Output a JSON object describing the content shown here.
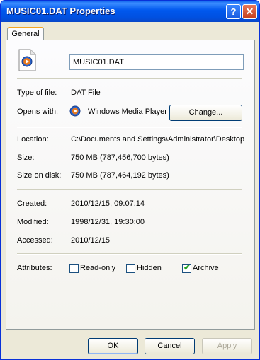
{
  "window": {
    "title": "MUSIC01.DAT Properties",
    "help_glyph": "?",
    "close_glyph": "✕"
  },
  "tabs": [
    "General"
  ],
  "file_name": "MUSIC01.DAT",
  "fields": {
    "type_label": "Type of file:",
    "type_value": "DAT File",
    "opens_label": "Opens with:",
    "opens_value": "Windows Media Player",
    "change_label": "Change...",
    "location_label": "Location:",
    "location_value": "C:\\Documents and Settings\\Administrator\\Desktop",
    "size_label": "Size:",
    "size_value": "750 MB (787,456,700 bytes)",
    "size_on_disk_label": "Size on disk:",
    "size_on_disk_value": "750 MB (787,464,192 bytes)",
    "created_label": "Created:",
    "created_value": "2010/12/15, 09:07:14",
    "modified_label": "Modified:",
    "modified_value": "1998/12/31, 19:30:00",
    "accessed_label": "Accessed:",
    "accessed_value": "2010/12/15",
    "attributes_label": "Attributes:"
  },
  "attributes": [
    {
      "label": "Read-only",
      "checked": false
    },
    {
      "label": "Hidden",
      "checked": false
    },
    {
      "label": "Archive",
      "checked": true
    }
  ],
  "buttons": {
    "ok": "OK",
    "cancel": "Cancel",
    "apply": "Apply"
  },
  "icons": {
    "file": "media-file-icon",
    "opens_with": "windows-media-player-icon"
  }
}
